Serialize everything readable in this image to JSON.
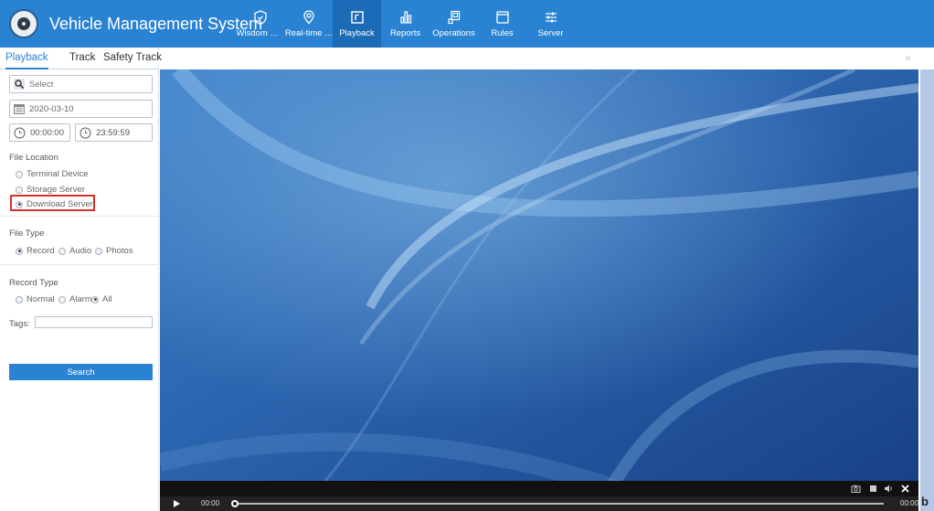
{
  "header": {
    "title": "Vehicle Management System",
    "nav": [
      {
        "label": "Wisdom Boa...",
        "icon": "shield-icon"
      },
      {
        "label": "Real-time ...",
        "icon": "location-pin-icon"
      },
      {
        "label": "Playback",
        "icon": "playback-icon",
        "active": true
      },
      {
        "label": "Reports",
        "icon": "bar-chart-icon"
      },
      {
        "label": "Operations",
        "icon": "operations-icon"
      },
      {
        "label": "Rules",
        "icon": "rules-icon"
      },
      {
        "label": "Server",
        "icon": "sliders-icon"
      }
    ]
  },
  "tabs": [
    "Playback",
    "Track",
    "Safety Track"
  ],
  "active_tab": "Playback",
  "search": {
    "placeholder": "Select"
  },
  "date": "2020-03-10",
  "time": {
    "start": "00:00:00",
    "end": "23:59:59"
  },
  "file_location": {
    "label": "File Location",
    "options": [
      "Terminal Device",
      "Storage Server",
      "Download Server"
    ],
    "selected": "Download Server"
  },
  "file_type": {
    "label": "File Type",
    "options": [
      "Record",
      "Audio",
      "Photos"
    ],
    "selected": "Record"
  },
  "record_type": {
    "label": "Record Type",
    "options": [
      "Normal",
      "Alarm",
      "All"
    ],
    "selected": "All"
  },
  "tags": {
    "label": "Tags:",
    "value": ""
  },
  "search_button": "Search",
  "collapse_glyph": "»",
  "player": {
    "current_time": "00:00",
    "total_time": "00:00",
    "progress": 0,
    "side_glyph": "b"
  },
  "colors": {
    "accent": "#2a83d2",
    "highlight": "#d4302c"
  }
}
